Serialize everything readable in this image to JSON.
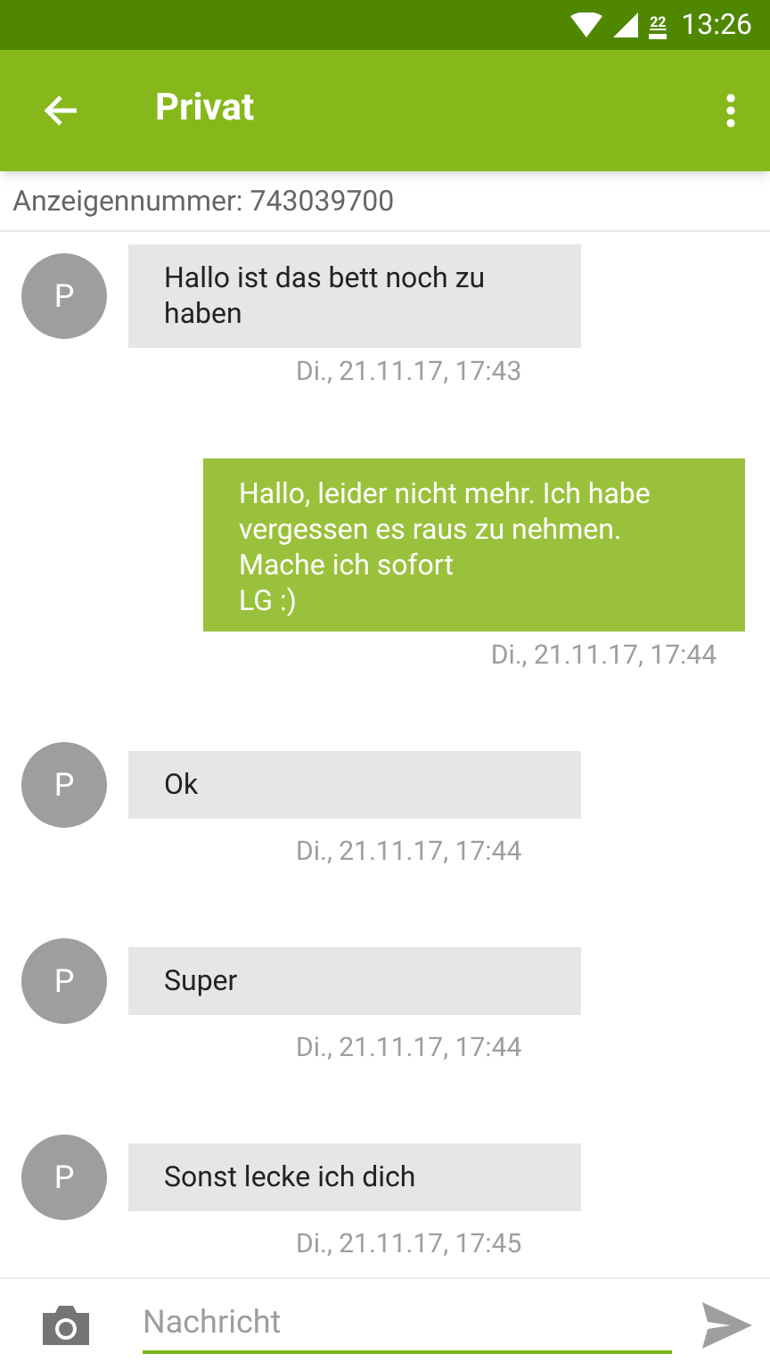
{
  "status_bar": {
    "battery": "22",
    "time": "13:26"
  },
  "app_bar": {
    "title": "Privat"
  },
  "ad_number": "Anzeigennummer: 743039700",
  "messages": [
    {
      "kind": "received",
      "avatar": "P",
      "text": "Hallo ist das bett noch zu haben",
      "time": "Di., 21.11.17, 17:43"
    },
    {
      "kind": "sent",
      "text": "Hallo, leider nicht mehr. Ich habe vergessen es raus zu nehmen.\nMache ich sofort\nLG :)",
      "time": "Di., 21.11.17, 17:44"
    },
    {
      "kind": "received",
      "avatar": "P",
      "text": "Ok",
      "time": "Di., 21.11.17, 17:44"
    },
    {
      "kind": "received",
      "avatar": "P",
      "text": "Super",
      "time": "Di., 21.11.17, 17:44"
    },
    {
      "kind": "received",
      "avatar": "P",
      "text": "Sonst lecke ich dich",
      "time": "Di., 21.11.17, 17:45"
    }
  ],
  "composer": {
    "placeholder": "Nachricht"
  }
}
